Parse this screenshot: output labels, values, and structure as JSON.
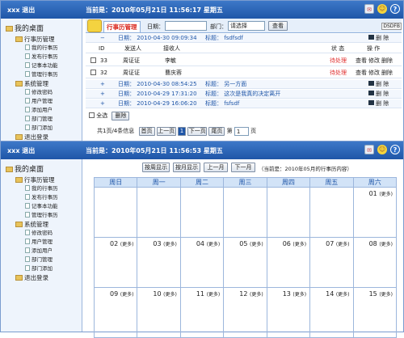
{
  "top": {
    "user": "xxx 退出",
    "datetime_1": "当前是：2010年05月21日 11:56:17 星期五",
    "datetime_2": "当前是：2010年05月21日 11:56:53 星期五"
  },
  "sidebar": {
    "root": "我的桌面",
    "groups": [
      {
        "label": "行事历管理",
        "items": [
          "我的行事历",
          "发布行事历",
          "记事本功能",
          "管理行事历"
        ]
      },
      {
        "label": "系统管理",
        "items": [
          "修改密码",
          "用户管理",
          "添加用户",
          "部门管理",
          "部门添加"
        ]
      }
    ],
    "logout": "退出登录"
  },
  "panel1": {
    "module": "行事历管理",
    "filter": {
      "date_label": "日期：",
      "dept_label": "部门：",
      "dept_select": "请选择",
      "search_btn": "查看"
    },
    "columns": {
      "id": "ID",
      "sender": "发送人",
      "receiver": "接收人",
      "status": "状 态",
      "op": "操 作"
    },
    "ops": {
      "view": "查看",
      "edit": "修改",
      "del": "删除"
    },
    "entries": [
      {
        "marker": "−",
        "date": "日期： 2010-04-30 09:09:34",
        "title": "标题： fsdfsdf",
        "op_label": "删 除",
        "subrows": [
          {
            "id": "33",
            "sender": "周证证",
            "receiver": "李敏",
            "status": "待处理"
          },
          {
            "id": "32",
            "sender": "周证证",
            "receiver": "曹庆蓉",
            "status": "待处理"
          }
        ]
      },
      {
        "marker": "+",
        "date": "日期： 2010-04-30 08:54:25",
        "title": "标题： 另一方面",
        "op_label": "删 除"
      },
      {
        "marker": "+",
        "date": "日期： 2010-04-29 17:31:20",
        "title": "标题： 这次是我真的决定离开",
        "op_label": "删 除"
      },
      {
        "marker": "+",
        "date": "日期： 2010-04-29 16:06:20",
        "title": "标题： fsfsdf",
        "op_label": "删 除"
      }
    ],
    "select_all": "全选",
    "delete_btn": "删除",
    "pager": {
      "info": "共1页/4条信息",
      "first": "首页",
      "prev": "上一页",
      "current": "1",
      "next": "下一页",
      "last": "尾页",
      "page_label": "第",
      "page_value": "1",
      "page_suffix": "页"
    },
    "scroll_label": "DSDFB"
  },
  "panel2": {
    "buttons": {
      "week": "按周显示",
      "month": "按月显示",
      "prev_month": "上一月",
      "next_month": "下一月"
    },
    "current": "（当前是：2010年05月的行事历内容）",
    "weekdays": [
      "周日",
      "周一",
      "周二",
      "周三",
      "周四",
      "周五",
      "周六"
    ],
    "more": "(更多)",
    "weeks": [
      [
        "",
        "",
        "",
        "",
        "",
        "",
        "01"
      ],
      [
        "02",
        "03",
        "04",
        "05",
        "06",
        "07",
        "08"
      ],
      [
        "09",
        "10",
        "11",
        "12",
        "13",
        "14",
        "15"
      ]
    ]
  }
}
